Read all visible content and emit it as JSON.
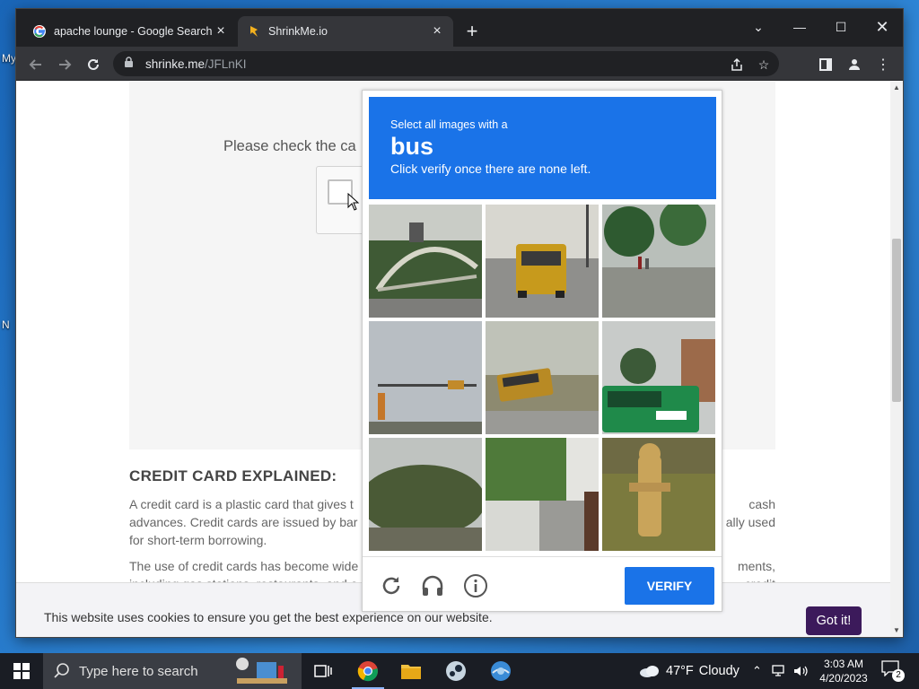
{
  "desktop": {
    "frag_my": "My",
    "frag_n": "N"
  },
  "browser": {
    "tabs": [
      {
        "title": "apache lounge - Google Search",
        "icon": "google-icon"
      },
      {
        "title": "ShrinkMe.io",
        "icon": "shrinkme-icon",
        "active": true
      }
    ],
    "new_tab": "+",
    "url_host": "shrinke.me",
    "url_path": "/JFLnKI"
  },
  "page": {
    "check_prompt": "Please check the ca",
    "heading": "CREDIT CARD EXPLAINED:",
    "para1_left": "A credit card is a plastic card that gives t",
    "para1_right": "cash",
    "para1_line2_left": "advances. Credit cards are issued by bar",
    "para1_line2_right": "ally used",
    "para1_line3": "for short-term borrowing.",
    "para2_left": "The use of credit cards has become wide",
    "para2_right": "ments,",
    "para2_line2_left": "including gas stations, restaurants, and o",
    "para2_line2_right": "credit",
    "cookie_text": "This website uses cookies to ensure you get the best experience on our website.",
    "cookie_button": "Got it!"
  },
  "captcha": {
    "pre": "Select all images with a",
    "object": "bus",
    "sub": "Click verify once there are none left.",
    "tiles": [
      "bridge",
      "school-bus-rear",
      "trees-people",
      "traffic-light",
      "school-bus-field",
      "green-bus",
      "shrubs",
      "houses-lawn",
      "fire-hydrant"
    ],
    "verify": "VERIFY",
    "accent": "#1a73e8"
  },
  "taskbar": {
    "search_placeholder": "Type here to search",
    "weather_temp": "47°F",
    "weather_text": "Cloudy",
    "time": "3:03 AM",
    "date": "4/20/2023",
    "notification_count": "2"
  }
}
